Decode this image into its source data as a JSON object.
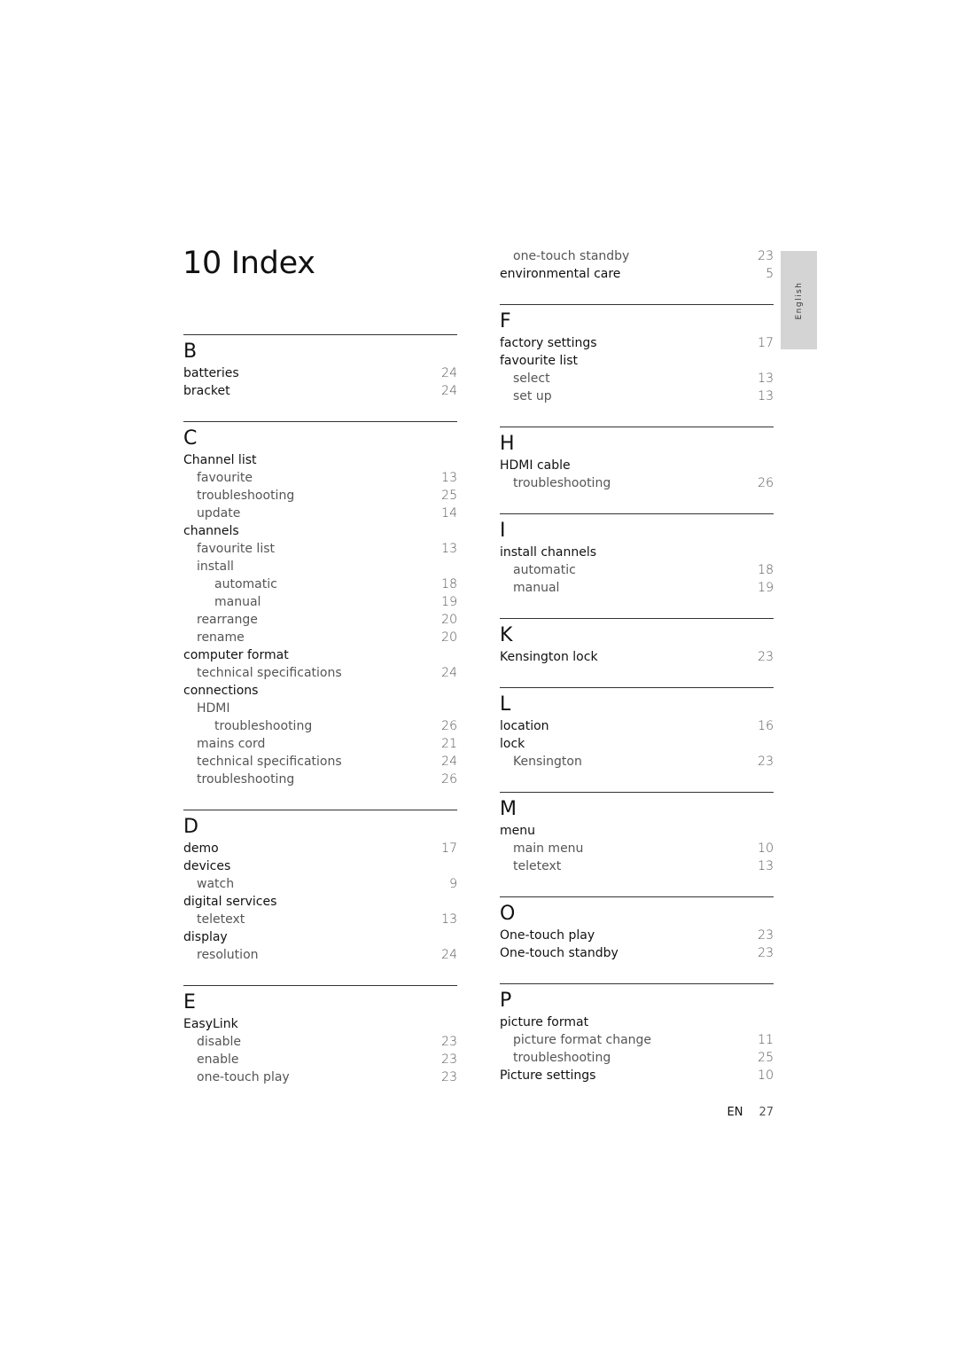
{
  "title": "10 Index",
  "language_tab": "English",
  "footer": {
    "lang": "EN",
    "page": "27"
  },
  "left_sections": [
    {
      "letter": "B",
      "entries": [
        {
          "label": "batteries",
          "page": "24",
          "level": 0
        },
        {
          "label": "bracket",
          "page": "24",
          "level": 0
        }
      ]
    },
    {
      "letter": "C",
      "entries": [
        {
          "label": "Channel list",
          "page": "",
          "level": 0
        },
        {
          "label": "favourite",
          "page": "13",
          "level": 1
        },
        {
          "label": "troubleshooting",
          "page": "25",
          "level": 1
        },
        {
          "label": "update",
          "page": "14",
          "level": 1
        },
        {
          "label": "channels",
          "page": "",
          "level": 0
        },
        {
          "label": "favourite list",
          "page": "13",
          "level": 1
        },
        {
          "label": "install",
          "page": "",
          "level": 1
        },
        {
          "label": "automatic",
          "page": "18",
          "level": 2
        },
        {
          "label": "manual",
          "page": "19",
          "level": 2
        },
        {
          "label": "rearrange",
          "page": "20",
          "level": 1
        },
        {
          "label": "rename",
          "page": "20",
          "level": 1
        },
        {
          "label": "computer format",
          "page": "",
          "level": 0
        },
        {
          "label": "technical specifications",
          "page": "24",
          "level": 1
        },
        {
          "label": "connections",
          "page": "",
          "level": 0
        },
        {
          "label": "HDMI",
          "page": "",
          "level": 1
        },
        {
          "label": "troubleshooting",
          "page": "26",
          "level": 2
        },
        {
          "label": "mains cord",
          "page": "21",
          "level": 1
        },
        {
          "label": "technical specifications",
          "page": "24",
          "level": 1
        },
        {
          "label": "troubleshooting",
          "page": "26",
          "level": 1
        }
      ]
    },
    {
      "letter": "D",
      "entries": [
        {
          "label": "demo",
          "page": "17",
          "level": 0
        },
        {
          "label": "devices",
          "page": "",
          "level": 0
        },
        {
          "label": "watch",
          "page": "9",
          "level": 1
        },
        {
          "label": "digital services",
          "page": "",
          "level": 0
        },
        {
          "label": "teletext",
          "page": "13",
          "level": 1
        },
        {
          "label": "display",
          "page": "",
          "level": 0
        },
        {
          "label": "resolution",
          "page": "24",
          "level": 1
        }
      ]
    },
    {
      "letter": "E",
      "entries": [
        {
          "label": "EasyLink",
          "page": "",
          "level": 0
        },
        {
          "label": "disable",
          "page": "23",
          "level": 1
        },
        {
          "label": "enable",
          "page": "23",
          "level": 1
        },
        {
          "label": "one-touch play",
          "page": "23",
          "level": 1
        }
      ]
    }
  ],
  "right_sections": [
    {
      "letter": "",
      "entries": [
        {
          "label": "one-touch standby",
          "page": "23",
          "level": 1
        },
        {
          "label": "environmental care",
          "page": "5",
          "level": 0
        }
      ]
    },
    {
      "letter": "F",
      "entries": [
        {
          "label": "factory settings",
          "page": "17",
          "level": 0
        },
        {
          "label": "favourite list",
          "page": "",
          "level": 0
        },
        {
          "label": "select",
          "page": "13",
          "level": 1
        },
        {
          "label": "set up",
          "page": "13",
          "level": 1
        }
      ]
    },
    {
      "letter": "H",
      "entries": [
        {
          "label": "HDMI cable",
          "page": "",
          "level": 0
        },
        {
          "label": "troubleshooting",
          "page": "26",
          "level": 1
        }
      ]
    },
    {
      "letter": "I",
      "entries": [
        {
          "label": "install channels",
          "page": "",
          "level": 0
        },
        {
          "label": "automatic",
          "page": "18",
          "level": 1
        },
        {
          "label": "manual",
          "page": "19",
          "level": 1
        }
      ]
    },
    {
      "letter": "K",
      "entries": [
        {
          "label": "Kensington lock",
          "page": "23",
          "level": 0
        }
      ]
    },
    {
      "letter": "L",
      "entries": [
        {
          "label": "location",
          "page": "16",
          "level": 0
        },
        {
          "label": "lock",
          "page": "",
          "level": 0
        },
        {
          "label": "Kensington",
          "page": "23",
          "level": 1
        }
      ]
    },
    {
      "letter": "M",
      "entries": [
        {
          "label": "menu",
          "page": "",
          "level": 0
        },
        {
          "label": "main menu",
          "page": "10",
          "level": 1
        },
        {
          "label": "teletext",
          "page": "13",
          "level": 1
        }
      ]
    },
    {
      "letter": "O",
      "entries": [
        {
          "label": "One-touch play",
          "page": "23",
          "level": 0
        },
        {
          "label": "One-touch standby",
          "page": "23",
          "level": 0
        }
      ]
    },
    {
      "letter": "P",
      "entries": [
        {
          "label": "picture format",
          "page": "",
          "level": 0
        },
        {
          "label": "picture format change",
          "page": "11",
          "level": 1
        },
        {
          "label": "troubleshooting",
          "page": "25",
          "level": 1
        },
        {
          "label": "Picture settings",
          "page": "10",
          "level": 0
        }
      ]
    }
  ]
}
